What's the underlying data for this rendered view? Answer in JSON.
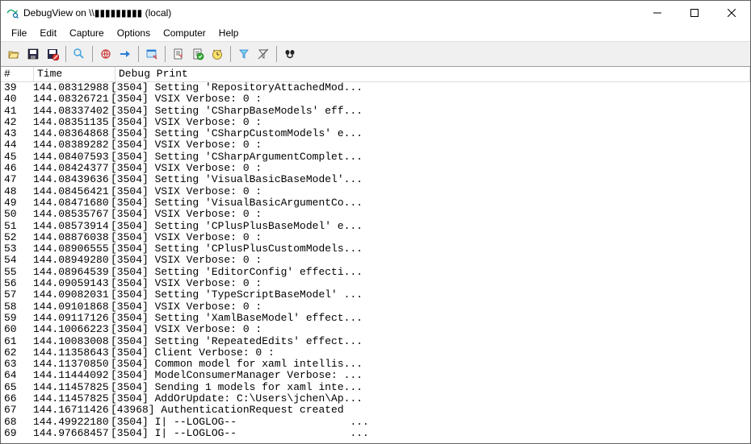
{
  "window": {
    "title": "DebugView on \\\\▮▮▮▮▮▮▮▮▮ (local)"
  },
  "menu": [
    "File",
    "Edit",
    "Capture",
    "Options",
    "Computer",
    "Help"
  ],
  "columns": [
    "#",
    "Time",
    "Debug Print"
  ],
  "rows": [
    {
      "n": "39",
      "t": "144.08312988",
      "p": "[3504] Setting 'RepositoryAttachedMod..."
    },
    {
      "n": "40",
      "t": "144.08326721",
      "p": "[3504] VSIX Verbose: 0 :"
    },
    {
      "n": "41",
      "t": "144.08337402",
      "p": "[3504] Setting 'CSharpBaseModels' eff..."
    },
    {
      "n": "42",
      "t": "144.08351135",
      "p": "[3504] VSIX Verbose: 0 :"
    },
    {
      "n": "43",
      "t": "144.08364868",
      "p": "[3504] Setting 'CSharpCustomModels' e..."
    },
    {
      "n": "44",
      "t": "144.08389282",
      "p": "[3504] VSIX Verbose: 0 :"
    },
    {
      "n": "45",
      "t": "144.08407593",
      "p": "[3504] Setting 'CSharpArgumentComplet..."
    },
    {
      "n": "46",
      "t": "144.08424377",
      "p": "[3504] VSIX Verbose: 0 :"
    },
    {
      "n": "47",
      "t": "144.08439636",
      "p": "[3504] Setting 'VisualBasicBaseModel'..."
    },
    {
      "n": "48",
      "t": "144.08456421",
      "p": "[3504] VSIX Verbose: 0 :"
    },
    {
      "n": "49",
      "t": "144.08471680",
      "p": "[3504] Setting 'VisualBasicArgumentCo..."
    },
    {
      "n": "50",
      "t": "144.08535767",
      "p": "[3504] VSIX Verbose: 0 :"
    },
    {
      "n": "51",
      "t": "144.08573914",
      "p": "[3504] Setting 'CPlusPlusBaseModel' e..."
    },
    {
      "n": "52",
      "t": "144.08876038",
      "p": "[3504] VSIX Verbose: 0 :"
    },
    {
      "n": "53",
      "t": "144.08906555",
      "p": "[3504] Setting 'CPlusPlusCustomModels..."
    },
    {
      "n": "54",
      "t": "144.08949280",
      "p": "[3504] VSIX Verbose: 0 :"
    },
    {
      "n": "55",
      "t": "144.08964539",
      "p": "[3504] Setting 'EditorConfig' effecti..."
    },
    {
      "n": "56",
      "t": "144.09059143",
      "p": "[3504] VSIX Verbose: 0 :"
    },
    {
      "n": "57",
      "t": "144.09082031",
      "p": "[3504] Setting 'TypeScriptBaseModel' ..."
    },
    {
      "n": "58",
      "t": "144.09101868",
      "p": "[3504] VSIX Verbose: 0 :"
    },
    {
      "n": "59",
      "t": "144.09117126",
      "p": "[3504] Setting 'XamlBaseModel' effect..."
    },
    {
      "n": "60",
      "t": "144.10066223",
      "p": "[3504] VSIX Verbose: 0 :"
    },
    {
      "n": "61",
      "t": "144.10083008",
      "p": "[3504] Setting 'RepeatedEdits' effect..."
    },
    {
      "n": "62",
      "t": "144.11358643",
      "p": "[3504] Client Verbose: 0 :"
    },
    {
      "n": "63",
      "t": "144.11370850",
      "p": "[3504] Common model for xaml intellis..."
    },
    {
      "n": "64",
      "t": "144.11444092",
      "p": "[3504] ModelConsumerManager Verbose: ..."
    },
    {
      "n": "65",
      "t": "144.11457825",
      "p": "[3504] Sending 1 models for xaml inte..."
    },
    {
      "n": "66",
      "t": "144.11457825",
      "p": "[3504] AddOrUpdate: C:\\Users\\jchen\\Ap..."
    },
    {
      "n": "67",
      "t": "144.16711426",
      "p": "[43968] AuthenticationRequest created"
    },
    {
      "n": "68",
      "t": "144.49922180",
      "p": "[3504] I| --LOGLOG--                  ..."
    },
    {
      "n": "69",
      "t": "144.97668457",
      "p": "[3504] I| --LOGLOG--                  ..."
    }
  ]
}
